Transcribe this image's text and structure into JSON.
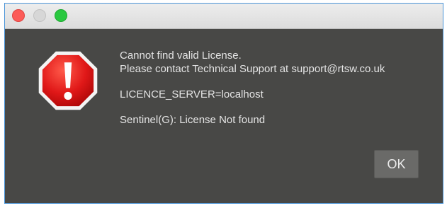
{
  "dialog": {
    "messages": {
      "line1": "Cannot find valid License.",
      "line2": "Please contact Technical Support at support@rtsw.co.uk",
      "line3": "LICENCE_SERVER=localhost",
      "line4": "Sentinel(G): License Not found"
    },
    "ok_label": "OK",
    "icon": "stop-alert-icon"
  },
  "colors": {
    "background": "#484846",
    "text": "#e4e4e4",
    "alert_red": "#e02020",
    "button": "#6a6a68"
  }
}
